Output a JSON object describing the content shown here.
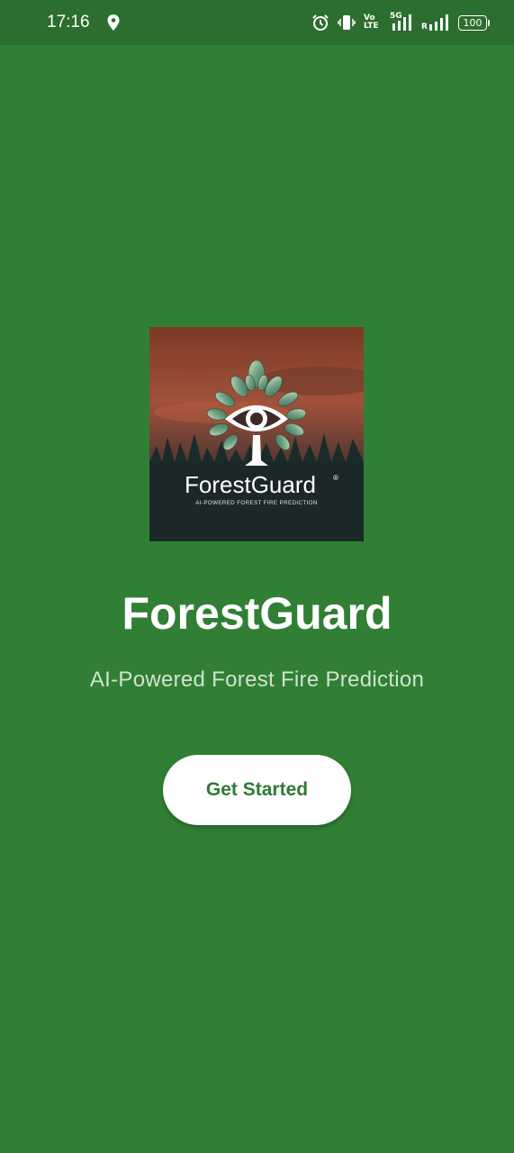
{
  "status_bar": {
    "time": "17:16",
    "network_badge": "5G",
    "volte_label": "Vo LTE",
    "roaming_label": "R",
    "battery_level": "100"
  },
  "logo": {
    "wordmark": "ForestGuard",
    "registered_mark": "®",
    "tagline": "AI-POWERED FOREST FIRE PREDICTION"
  },
  "main": {
    "title": "ForestGuard",
    "subtitle": "AI-Powered Forest Fire Prediction",
    "cta_label": "Get Started"
  },
  "colors": {
    "background": "#317f35",
    "status_bar": "#2b6e2f",
    "button_bg": "#ffffff",
    "button_text": "#2f7a33"
  }
}
